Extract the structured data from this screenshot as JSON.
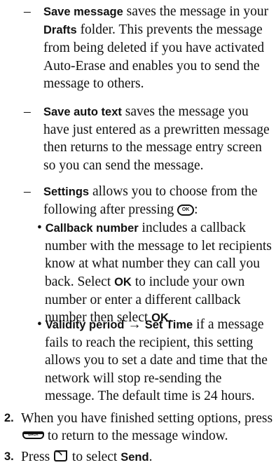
{
  "items": {
    "save_message": {
      "dash": "–",
      "term": "Save message",
      "t1": " saves the message in your ",
      "folder": "Drafts",
      "t2": " folder. This prevents the message from being deleted if you have activated Auto-Erase and enables you to send the message to others."
    },
    "save_auto_text": {
      "dash": "–",
      "term": "Save auto text",
      "t1": " saves the message you have just entered as a prewritten message then returns to the message entry screen so you can send the message."
    },
    "settings": {
      "dash": "–",
      "term": "Settings",
      "t1": " allows you to choose from the following after pressing ",
      "key_label": "OK",
      "t2": ":"
    },
    "callback": {
      "bullet": "•",
      "term": "Callback number",
      "t1": " includes a callback number with the message to let recipients know at what number they can call you back. Select ",
      "ok1": "OK",
      "t2": " to include your own number or enter a different callback number then select ",
      "ok2": "OK",
      "t3": "."
    },
    "validity": {
      "bullet": "•",
      "term": "Validity period",
      "arrow": " → ",
      "term2": "Set Time",
      "t1": " if a message fails to reach the recipient, this setting allows you to set a date and time that the network will stop re-sending the message. The default time is 24 hours."
    }
  },
  "steps": [
    {
      "num": "2.",
      "t1": "When you have finished setting options, press ",
      "key_label": "BACK",
      "t2": " to return to the message window."
    },
    {
      "num": "3.",
      "t1": "Press ",
      "t2": " to select ",
      "term": "Send",
      "t3": "."
    }
  ]
}
